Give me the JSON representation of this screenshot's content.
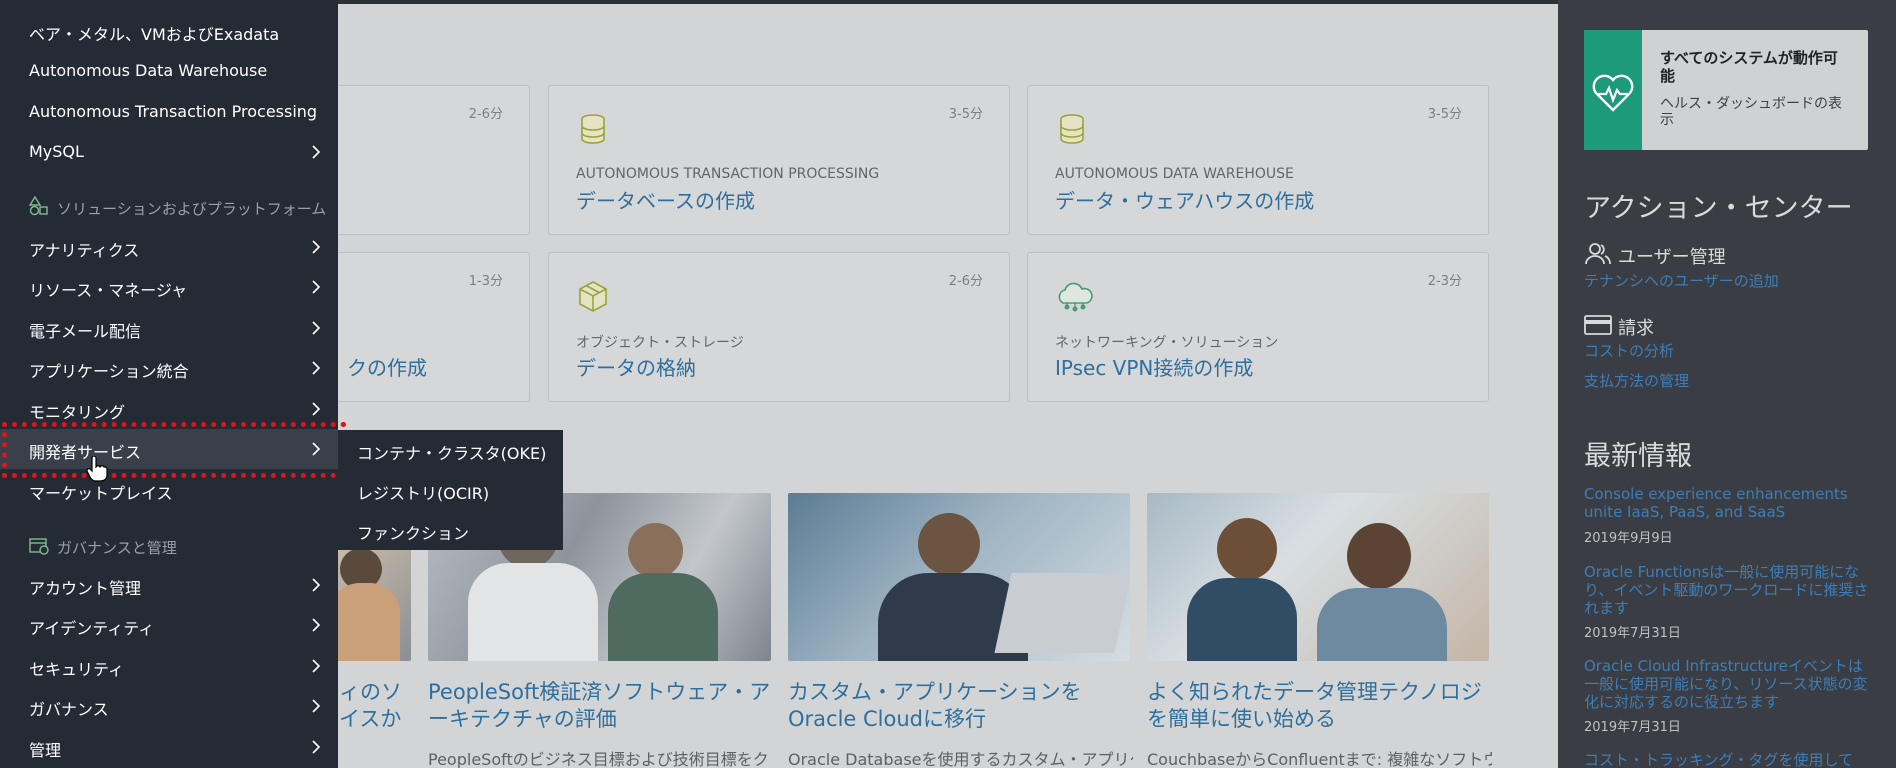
{
  "nav": {
    "items_top": [
      {
        "label": "ベア・メタル、VMおよびExadata",
        "has_arrow": false
      },
      {
        "label": "Autonomous Data Warehouse",
        "has_arrow": false
      },
      {
        "label": "Autonomous Transaction Processing",
        "has_arrow": false
      },
      {
        "label": "MySQL",
        "has_arrow": true
      }
    ],
    "section_solutions": {
      "label": "ソリューションおよびプラットフォーム",
      "icon": "shapes-icon"
    },
    "items_solutions": [
      {
        "label": "アナリティクス"
      },
      {
        "label": "リソース・マネージャ"
      },
      {
        "label": "電子メール配信"
      },
      {
        "label": "アプリケーション統合"
      },
      {
        "label": "モニタリング"
      },
      {
        "label": "開発者サービス",
        "active": true
      },
      {
        "label": "マーケットプレイス"
      }
    ],
    "section_governance": {
      "label": "ガバナンスと管理",
      "icon": "governance-icon"
    },
    "items_governance": [
      {
        "label": "アカウント管理"
      },
      {
        "label": "アイデンティティ"
      },
      {
        "label": "セキュリティ"
      },
      {
        "label": "ガバナンス"
      },
      {
        "label": "管理"
      }
    ]
  },
  "submenu": {
    "items": [
      {
        "label": "コンテナ・クラスタ(OKE)"
      },
      {
        "label": "レジストリ(OCIR)"
      },
      {
        "label": "ファンクション"
      }
    ]
  },
  "quick_actions": {
    "row1": [
      {
        "duration": "2-6分",
        "category": "",
        "title": ""
      },
      {
        "duration": "3-5分",
        "category": "AUTONOMOUS TRANSACTION PROCESSING",
        "title": "データベースの作成",
        "icon": "database-icon"
      },
      {
        "duration": "3-5分",
        "category": "AUTONOMOUS DATA WAREHOUSE",
        "title": "データ・ウェアハウスの作成",
        "icon": "database-icon"
      }
    ],
    "row2": [
      {
        "duration": "1-3分",
        "category": "",
        "title": "クの作成"
      },
      {
        "duration": "2-6分",
        "category": "オブジェクト・ストレージ",
        "title": "データの格納",
        "icon": "cube-icon"
      },
      {
        "duration": "2-3分",
        "category": "ネットワーキング・ソリューション",
        "title": "IPsec VPN接続の作成",
        "icon": "network-cloud-icon"
      }
    ]
  },
  "articles": [
    {
      "title_lines": [
        "ィのソ",
        "イスか"
      ],
      "desc": ""
    },
    {
      "title_lines": [
        "PeopleSoft検証済ソフトウェア・ア",
        "ーキテクチャの評価"
      ],
      "desc": "PeopleSoftのビジネス目標および技術目標をク"
    },
    {
      "title_lines": [
        "カスタム・アプリケーションを",
        "Oracle Cloudに移行"
      ],
      "desc": "Oracle Databaseを使用するカスタム・アプリケ"
    },
    {
      "title_lines": [
        "よく知られたデータ管理テクノロジ",
        "を簡単に使い始める"
      ],
      "desc": "CouchbaseからConfluentまで: 複雑なソフトウェ"
    }
  ],
  "right_panel": {
    "health": {
      "title": "すべてのシステムが動作可能",
      "link": "ヘルス・ダッシュボードの表示",
      "icon": "heartbeat-icon",
      "color": "#1d9a7a"
    },
    "action_center": {
      "heading": "アクション・センター",
      "user_mgmt": {
        "label": "ユーザー管理",
        "icon": "users-icon",
        "links": [
          "テナンシへのユーザーの追加"
        ]
      },
      "billing": {
        "label": "請求",
        "icon": "credit-card-icon",
        "links": [
          "コストの分析",
          "支払方法の管理"
        ]
      }
    },
    "news": {
      "heading": "最新情報",
      "items": [
        {
          "title": "Console experience enhancements unite IaaS, PaaS, and SaaS",
          "date": "2019年9月9日"
        },
        {
          "title": "Oracle Functionsは一般に使用可能になり、イベント駆動のワークロードに推奨されます",
          "date": "2019年7月31日"
        },
        {
          "title": "Oracle Cloud Infrastructureイベントは一般に使用可能になり、リソース状態の変化に対応するのに役立ちます",
          "date": "2019年7月31日"
        },
        {
          "title": "コスト・トラッキング・タグを使用して",
          "date": ""
        }
      ]
    }
  },
  "colors": {
    "link": "#3e7db6",
    "nav_bg": "#252b35",
    "highlight": "#e0141c",
    "accent": "#1d9a7a"
  }
}
